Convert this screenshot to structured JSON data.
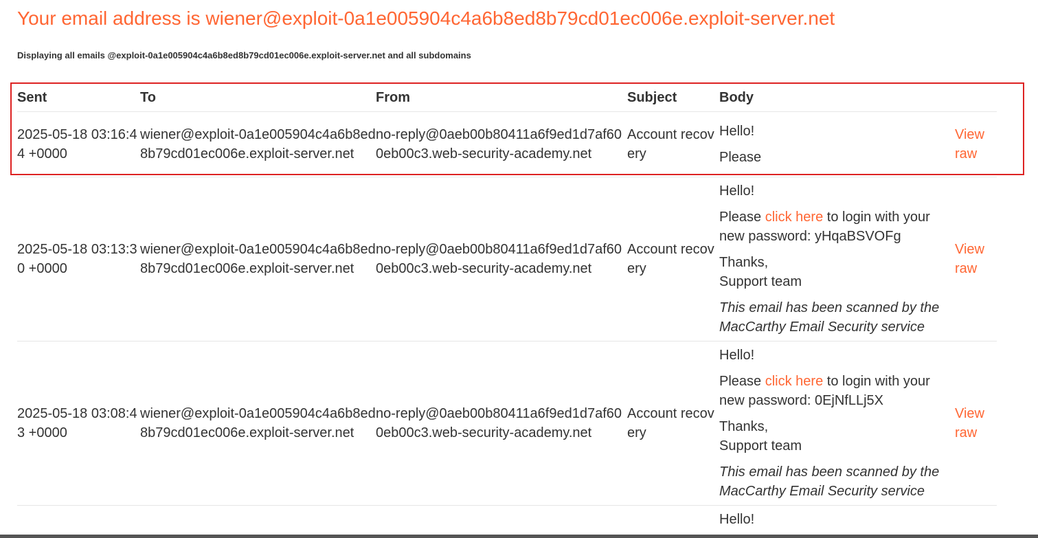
{
  "header": {
    "title": "Your email address is wiener@exploit-0a1e005904c4a6b8ed8b79cd01ec006e.exploit-server.net",
    "subtitle": "Displaying all emails @exploit-0a1e005904c4a6b8ed8b79cd01ec006e.exploit-server.net and all subdomains"
  },
  "table": {
    "columns": [
      "Sent",
      "To",
      "From",
      "Subject",
      "Body"
    ],
    "rows": [
      {
        "sent": "2025-05-18 03:16:44 +0000",
        "to": "wiener@exploit-0a1e005904c4a6b8ed8b79cd01ec006e.exploit-server.net",
        "from": "no-reply@0aeb00b80411a6f9ed1d7af600eb00c3.web-security-academy.net",
        "subject": "Account recovery",
        "body_greeting": "Hello!",
        "body_line": "Please",
        "view_raw": "View raw"
      },
      {
        "sent": "2025-05-18 03:13:30 +0000",
        "to": "wiener@exploit-0a1e005904c4a6b8ed8b79cd01ec006e.exploit-server.net",
        "from": "no-reply@0aeb00b80411a6f9ed1d7af600eb00c3.web-security-academy.net",
        "subject": "Account recovery",
        "body_greeting": "Hello!",
        "body_pre": "Please ",
        "body_link": "click here",
        "body_post": " to login with your new password: yHqaBSVOFg",
        "body_thanks": "Thanks,",
        "body_sign": "Support team",
        "body_note": "This email has been scanned by the MacCarthy Email Security service",
        "view_raw": "View raw"
      },
      {
        "sent": "2025-05-18 03:08:43 +0000",
        "to": "wiener@exploit-0a1e005904c4a6b8ed8b79cd01ec006e.exploit-server.net",
        "from": "no-reply@0aeb00b80411a6f9ed1d7af600eb00c3.web-security-academy.net",
        "subject": "Account recovery",
        "body_greeting": "Hello!",
        "body_pre": "Please ",
        "body_link": "click here",
        "body_post": " to login with your new password: 0EjNfLLj5X",
        "body_thanks": "Thanks,",
        "body_sign": "Support team",
        "body_note": "This email has been scanned by the MacCarthy Email Security service",
        "view_raw": "View raw"
      },
      {
        "body_greeting": "Hello!"
      }
    ]
  },
  "colors": {
    "accent": "#ff6633",
    "text": "#333333",
    "highlight_border": "#dd2222"
  }
}
